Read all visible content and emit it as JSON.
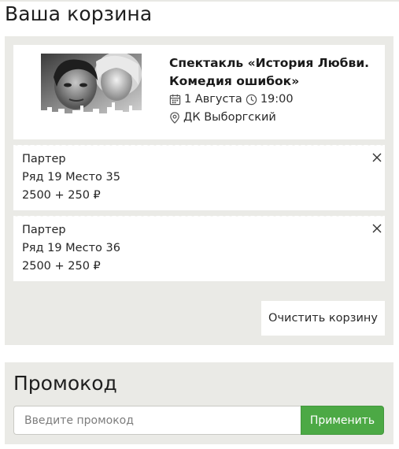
{
  "cart": {
    "title": "Ваша корзина",
    "event": {
      "name_line1": "Спектакль «История Любви.",
      "name_line2": "Комедия ошибок»",
      "date": "1 Августа",
      "time": "19:00",
      "venue": "ДК Выборгский",
      "poster_icon": "event-poster-image"
    },
    "tickets": [
      {
        "section": "Партер",
        "seat": "Ряд 19 Место 35",
        "price": "2500 + 250 ₽"
      },
      {
        "section": "Партер",
        "seat": "Ряд 19 Место 36",
        "price": "2500 + 250 ₽"
      }
    ],
    "clear_button": "Очистить корзину"
  },
  "promo": {
    "title": "Промокод",
    "input_placeholder": "Введите промокод",
    "input_value": "",
    "apply_button": "Применить"
  },
  "colors": {
    "panel_bg": "#eaeae6",
    "card_bg": "#ffffff",
    "accent_green": "#4ca945",
    "text": "#222222"
  }
}
